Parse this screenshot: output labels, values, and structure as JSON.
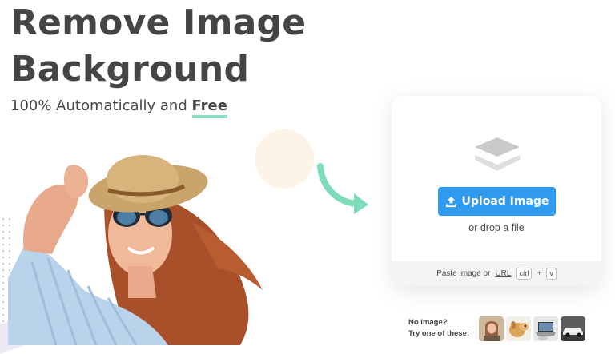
{
  "hero": {
    "title_line1": "Remove Image",
    "title_line2": "Background",
    "subtitle_prefix": "100% Automatically and ",
    "subtitle_highlight": "Free"
  },
  "upload": {
    "button_label": "Upload Image",
    "drop_text": "or drop a file",
    "paste_text": "Paste image or",
    "url_link": "URL",
    "shortcut_key1": "ctrl",
    "shortcut_plus": "+",
    "shortcut_key2": "v"
  },
  "samples": {
    "label_line1": "No image?",
    "label_line2": "Try one of these:",
    "thumbnails": [
      "woman-thumbnail",
      "dog-thumbnail",
      "laptop-thumbnail",
      "car-thumbnail"
    ]
  },
  "colors": {
    "accent_blue": "#2f9bf0",
    "highlight_green": "#8fe0c1",
    "text_dark": "#454545"
  }
}
